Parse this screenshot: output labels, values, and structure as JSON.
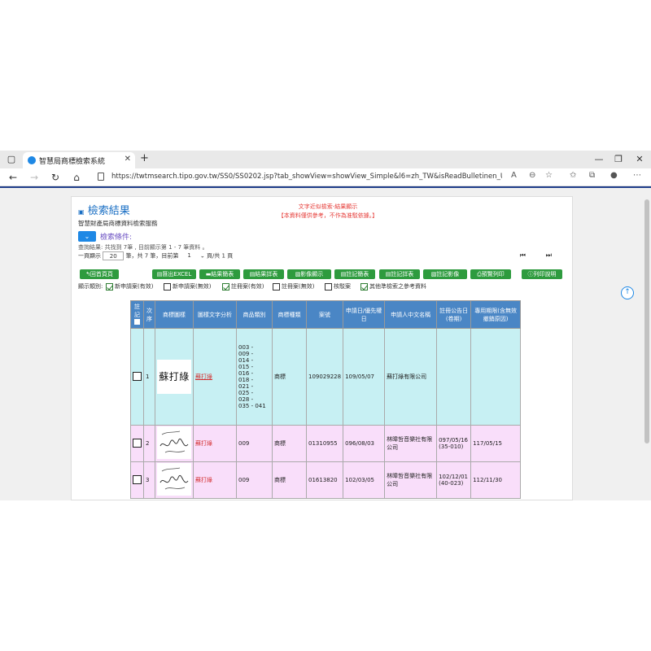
{
  "browser": {
    "tab_title": "智慧局商標檢索系統",
    "url": "https://twtmsearch.tipo.gov.tw/SS0/SS0202.jsp?tab_showView=showView_Simple&l6=zh_TW&isReadBulletinen_US=&isReadBulleti...",
    "icons": [
      "window-icon",
      "favicon",
      "close-icon",
      "plus-icon",
      "back-icon",
      "forward-icon",
      "refresh-icon",
      "home-icon",
      "lock-icon",
      "read-aloud-icon",
      "zoom-icon",
      "favorites-icon",
      "collections-icon",
      "profile-icon",
      "more-icon"
    ]
  },
  "page": {
    "title": "檢索結果",
    "subtitle": "智慧財產局商標資料檢索服務",
    "notice_line1": "文字近似檢索-結果顯示",
    "notice_line2": "【本資料僅供參考，不作為准駁依據。】",
    "conditions_label": "檢索條件:",
    "summary": "查詢結果: 共找到 7筆 , 目前顯示第 1 - 7 筆資料 。",
    "pager": {
      "per_page_prefix": "一頁顯示",
      "per_page_value": "20",
      "per_page_suffix": "筆，共 7 筆，目前第",
      "current_page": "1",
      "total_suffix": "頁/共 1 頁"
    }
  },
  "buttons": [
    {
      "label": "↰回首頁頁"
    },
    {
      "label": "▤匯出EXCEL"
    },
    {
      "label": "▬結果簡表"
    },
    {
      "label": "▤結果詳表"
    },
    {
      "label": "▧影像顯示"
    },
    {
      "label": "▤註記簡表"
    },
    {
      "label": "▤註記詳表"
    },
    {
      "label": "▧註記影像"
    },
    {
      "label": "⎙預覽列印"
    },
    {
      "label": "ⓘ列印說明"
    }
  ],
  "filters": {
    "prefix": "顯示類別:",
    "items": [
      {
        "label": "新申請案(有效)",
        "checked": true
      },
      {
        "label": "新申請案(無效)",
        "checked": false
      },
      {
        "label": "註冊案(有效)",
        "checked": true
      },
      {
        "label": "註冊案(無效)",
        "checked": false
      },
      {
        "label": "核駁案",
        "checked": false
      },
      {
        "label": "其他準檢索之參考資料",
        "checked": true
      }
    ]
  },
  "table": {
    "headers": {
      "mark": "註記",
      "seq": "次序",
      "image": "商標圖樣",
      "text": "圖樣文字分析",
      "classes": "商品類別",
      "type": "商標種類",
      "number": "案號",
      "date": "申請日/優先權日",
      "applicant": "申請人中文名稱",
      "pub": "註冊公告日(卷期)",
      "expiry": "專用期限(含無效撤銷原因)"
    },
    "rows": [
      {
        "seq": "1",
        "image_text": "蘇打綠",
        "text": "蘇打綠",
        "classes": [
          "003 -",
          "009 -",
          "014 -",
          "015 -",
          "016 -",
          "018 -",
          "021 -",
          "025 -",
          "028 -",
          "035 - 041"
        ],
        "type": "商標",
        "number": "109029228",
        "date": "109/05/07",
        "applicant": "蘇打綠有限公司",
        "pub": "",
        "expiry": ""
      },
      {
        "seq": "2",
        "image_text": "",
        "text": "蘇打綠",
        "classes": [
          "009"
        ],
        "type": "商標",
        "number": "01310955",
        "date": "096/08/03",
        "applicant": "林暐哲音樂社有限公司",
        "pub": "097/05/16 (35-010)",
        "expiry": "117/05/15"
      },
      {
        "seq": "3",
        "image_text": "",
        "text": "蘇打綠",
        "classes": [
          "009"
        ],
        "type": "商標",
        "number": "01613820",
        "date": "102/03/05",
        "applicant": "林暐哲音樂社有限公司",
        "pub": "102/12/01 (40-023)",
        "expiry": "112/11/30"
      }
    ]
  },
  "colors": {
    "accent_blue": "#1a6fc4",
    "button_green": "#2e9b3e",
    "header_blue": "#4a86c5",
    "row_cyan": "#c7f0f3",
    "row_pink": "#f9defa",
    "alert_red": "#e53935"
  }
}
